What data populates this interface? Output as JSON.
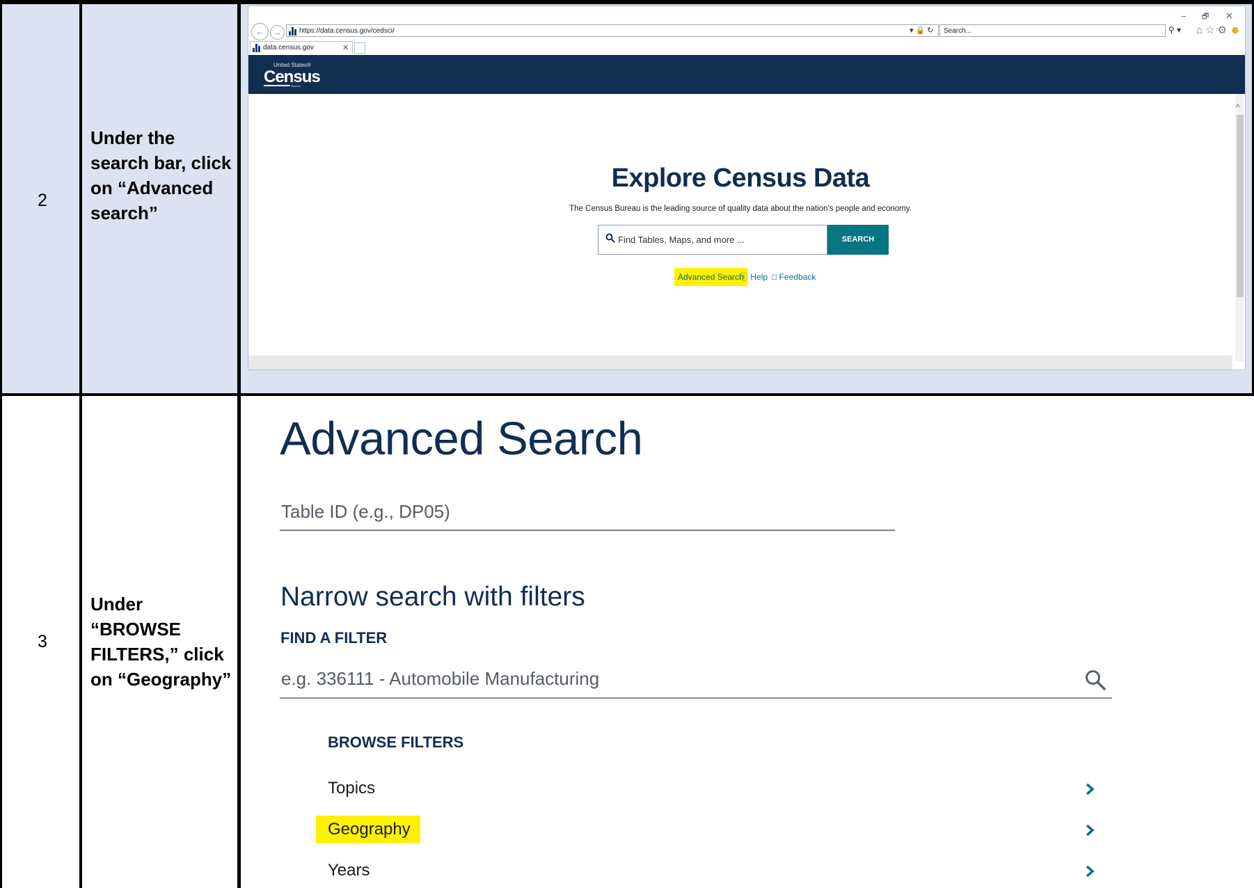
{
  "rows": [
    {
      "step": "2",
      "instruction_lines": [
        "Under the",
        "search bar, click",
        "on “Advanced",
        "search”"
      ]
    },
    {
      "step": "3",
      "instruction_lines": [
        "Under",
        "“BROWSE",
        "FILTERS,” click",
        "on “Geography”"
      ]
    }
  ],
  "browser": {
    "url": "https://data.census.gov/cedsci/",
    "search_placeholder": "Search...",
    "tab_title": "data.census.gov",
    "window_controls": [
      "–",
      "🗗",
      "✕"
    ]
  },
  "census": {
    "logo_top": "United States®",
    "logo_main": "Census",
    "logo_bottom": "Bureau",
    "title": "Explore Census Data",
    "subtitle": "The Census Bureau is the leading source of quality data about the nation's people and economy.",
    "search_placeholder": "Find Tables, Maps, and more ...",
    "search_button": "SEARCH",
    "links": {
      "advanced": "Advanced Search",
      "help": "Help",
      "feedback": "Feedback"
    }
  },
  "advanced": {
    "title": "Advanced Search",
    "table_id_placeholder": "Table ID (e.g., DP05)",
    "narrow_title": "Narrow search with filters",
    "find_filter_label": "FIND A FILTER",
    "filter_placeholder": "e.g. 336111 - Automobile Manufacturing",
    "browse_title": "BROWSE FILTERS",
    "items": [
      "Topics",
      "Geography",
      "Years"
    ]
  },
  "colors": {
    "row2_bg": "#dbe3f2",
    "census_navy": "#112e51",
    "teal": "#087583",
    "highlight": "#fff200"
  }
}
